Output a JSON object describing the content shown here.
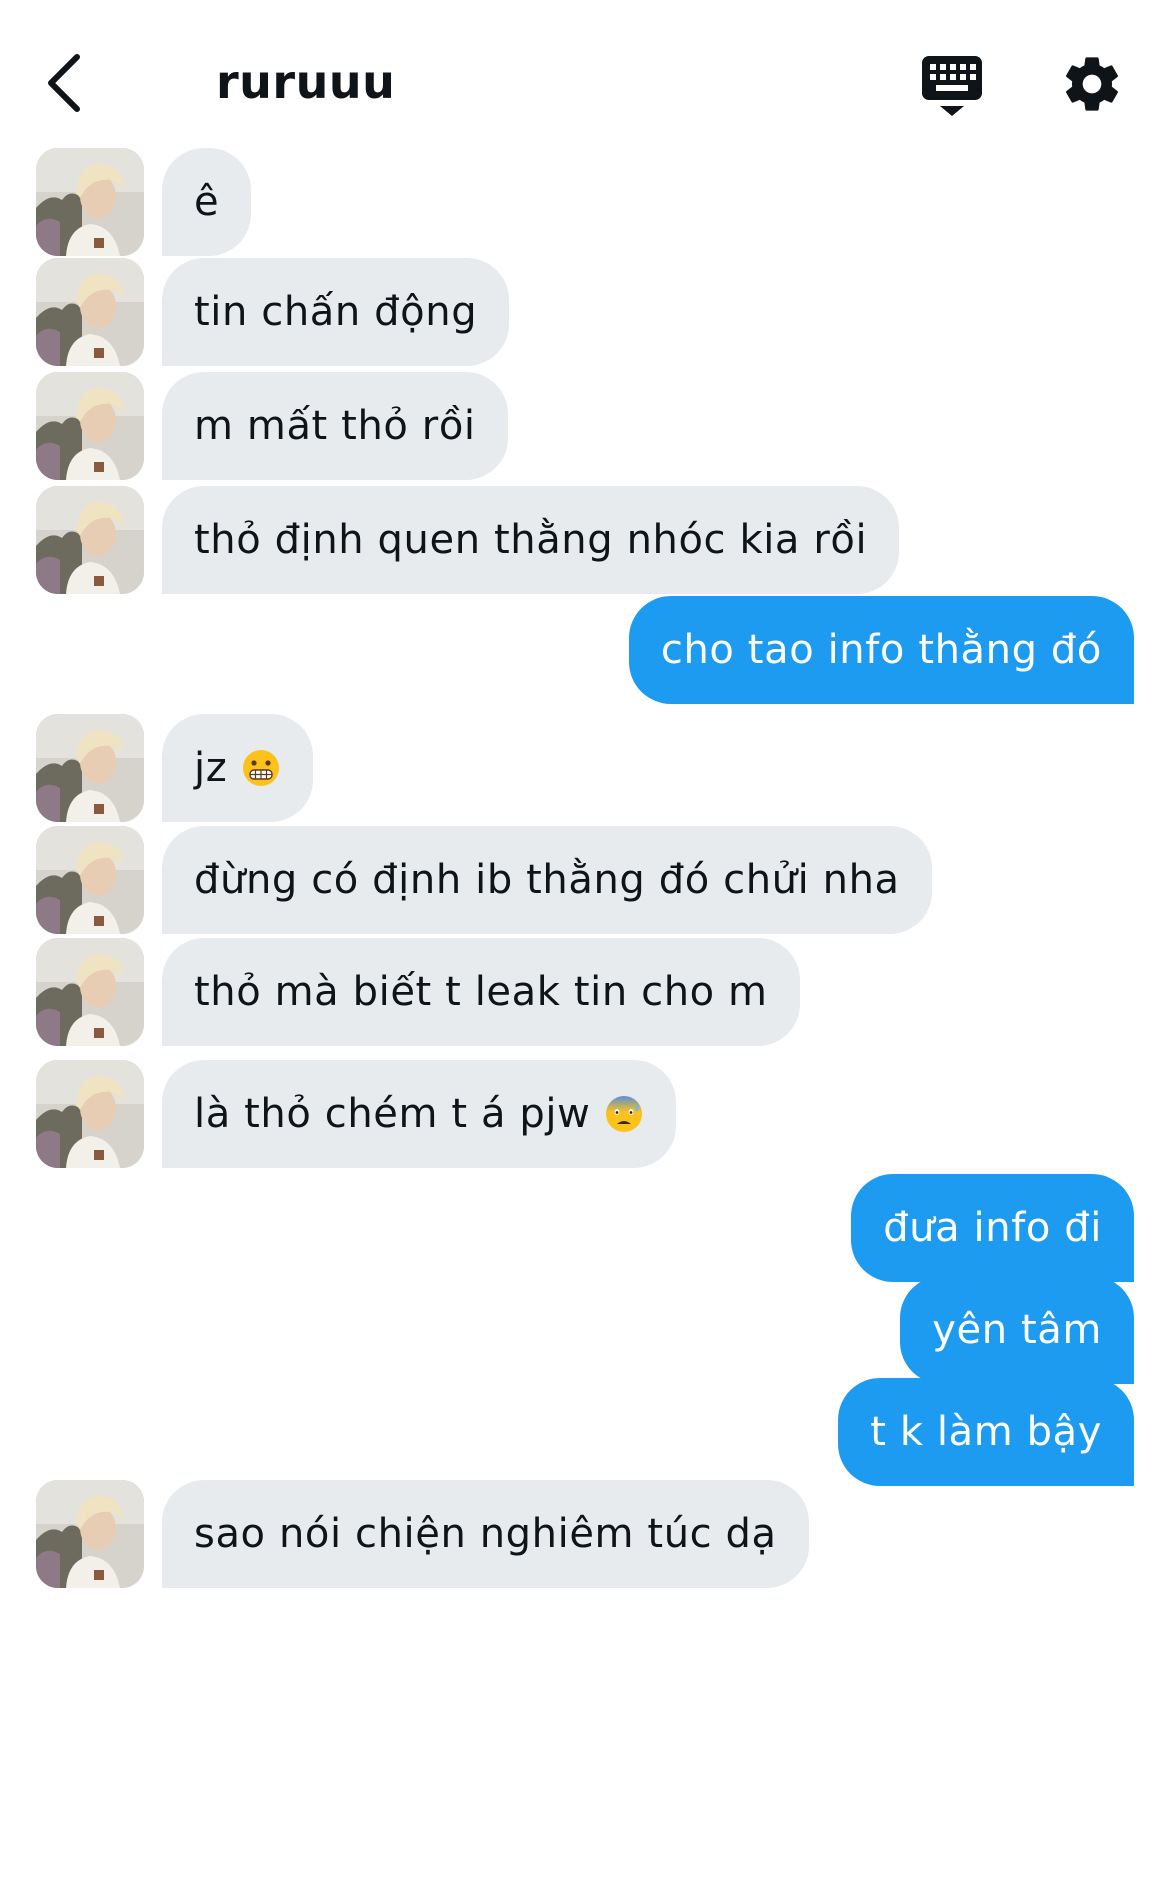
{
  "header": {
    "title": "ruruuu",
    "icons": {
      "back": "chevron-left-icon",
      "keyboard": "keyboard-icon",
      "settings": "gear-icon"
    }
  },
  "messages": [
    {
      "id": "m1",
      "sender": "other",
      "text": "ê"
    },
    {
      "id": "m2",
      "sender": "other",
      "text": "tin chấn động"
    },
    {
      "id": "m3",
      "sender": "other",
      "text": "m mất thỏ rồi"
    },
    {
      "id": "m4",
      "sender": "other",
      "text": "thỏ định quen thằng nhóc kia rồi"
    },
    {
      "id": "m5",
      "sender": "me",
      "text": "cho tao info thằng đó"
    },
    {
      "id": "m6",
      "sender": "other",
      "text": "jz",
      "emoji": "grimacing-face-emoji"
    },
    {
      "id": "m7",
      "sender": "other",
      "text": "đừng có định ib thằng đó chửi nha"
    },
    {
      "id": "m8",
      "sender": "other",
      "text": "thỏ mà biết t leak tin cho m"
    },
    {
      "id": "m9",
      "sender": "other",
      "text": "là thỏ chém t á pjw",
      "emoji": "anxious-face-with-sweat-emoji"
    },
    {
      "id": "m10",
      "sender": "me",
      "text": "đưa info đi"
    },
    {
      "id": "m11",
      "sender": "me",
      "text": "yên tâm"
    },
    {
      "id": "m12",
      "sender": "me",
      "text": "t k làm bậy"
    },
    {
      "id": "m13",
      "sender": "other",
      "text": "sao nói chiện nghiêm túc dạ"
    }
  ],
  "colors": {
    "outgoing_bubble": "#1d9bf0",
    "incoming_bubble": "#e8ebee",
    "text": "#0f1419"
  }
}
